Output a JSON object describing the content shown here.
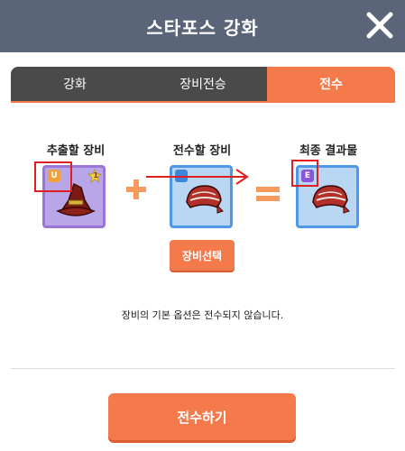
{
  "header": {
    "title": "스타포스 강화"
  },
  "tabs": [
    {
      "label": "강화"
    },
    {
      "label": "장비전승"
    },
    {
      "label": "전수"
    }
  ],
  "columns": {
    "source": {
      "label": "추출할 장비",
      "badge": "U",
      "star_level": "1"
    },
    "target": {
      "label": "전수할 장비",
      "badge": ""
    },
    "result": {
      "label": "최종 결과물",
      "badge": "E"
    }
  },
  "buttons": {
    "select_equipment": "장비선택",
    "transfer": "전수하기"
  },
  "notice": "장비의 기본 옵션은 전수되지 않습니다.",
  "colors": {
    "header_bg": "#5b6579",
    "accent": "#f47a4c",
    "tab_inactive": "#4a4a4a",
    "annotation_red": "#e02020"
  }
}
